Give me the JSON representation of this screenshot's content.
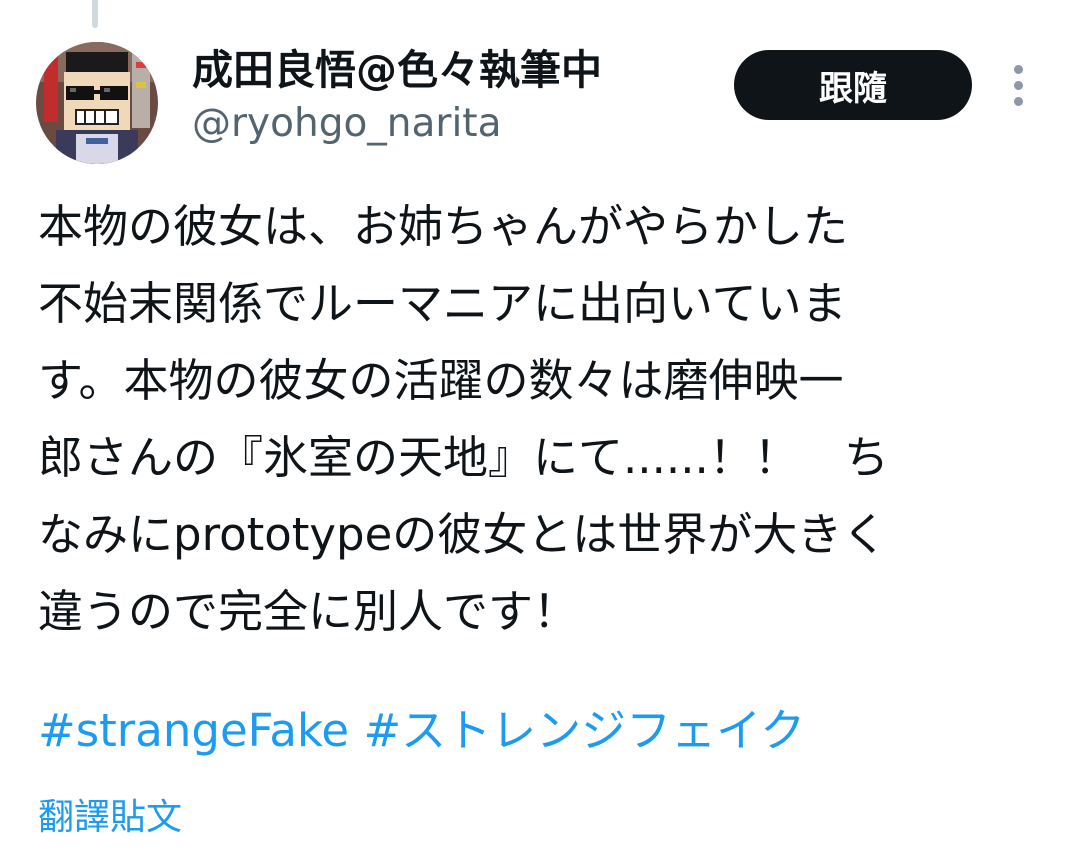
{
  "author": {
    "display_name": "成田良悟@色々執筆中",
    "handle": "@ryohgo_narita",
    "avatar_icon": "pixel-art-avatar-icon"
  },
  "actions": {
    "follow_label": "跟隨",
    "more_icon": "more-vertical-icon"
  },
  "tweet": {
    "lines": [
      "本物の彼女は、お姉ちゃんがやらかした",
      "不始末関係でルーマニアに出向いていま",
      "す。本物の彼女の活躍の数々は磨伸映一",
      "郎さんの『氷室の天地』にて......！！　ち",
      "なみにprototypeの彼女とは世界が大きく",
      "違うので完全に別人です！"
    ],
    "hashtags": [
      "#strangeFake",
      "#ストレンジフェイク"
    ],
    "translate_label": "翻譯貼文"
  },
  "colors": {
    "link": "#1d9bf0",
    "follow_bg": "#0f1419",
    "secondary_text": "#536471"
  }
}
